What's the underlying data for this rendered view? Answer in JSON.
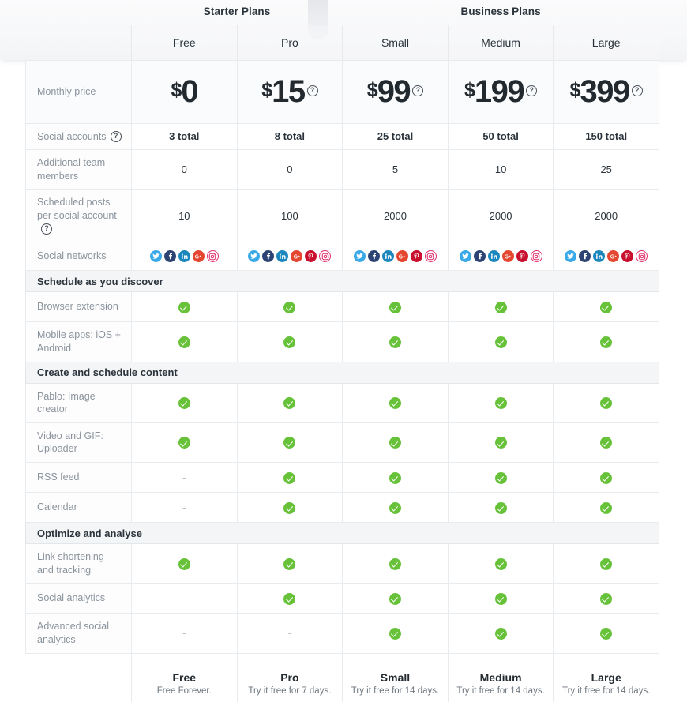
{
  "groups": [
    {
      "label": "Starter Plans",
      "span": 2
    },
    {
      "label": "Business Plans",
      "span": 3
    }
  ],
  "plans": [
    {
      "name": "Free",
      "price_currency": "$",
      "price_amount": "0",
      "has_help": false
    },
    {
      "name": "Pro",
      "price_currency": "$",
      "price_amount": "15",
      "has_help": true
    },
    {
      "name": "Small",
      "price_currency": "$",
      "price_amount": "99",
      "has_help": true
    },
    {
      "name": "Medium",
      "price_currency": "$",
      "price_amount": "199",
      "has_help": true
    },
    {
      "name": "Large",
      "price_currency": "$",
      "price_amount": "399",
      "has_help": true
    }
  ],
  "rows": {
    "monthly_price_label": "Monthly price",
    "social_accounts_label": "Social accounts",
    "social_accounts_values": [
      "3 total",
      "8 total",
      "25 total",
      "50 total",
      "150 total"
    ],
    "team_members_label": "Additional team members",
    "team_members_values": [
      "0",
      "0",
      "5",
      "10",
      "25"
    ],
    "scheduled_posts_label": "Scheduled posts per social account",
    "scheduled_posts_values": [
      "10",
      "100",
      "2000",
      "2000",
      "2000"
    ],
    "social_networks_label": "Social networks",
    "social_networks_values": [
      [
        "twitter",
        "facebook",
        "linkedin",
        "googleplus",
        "instagram"
      ],
      [
        "twitter",
        "facebook",
        "linkedin",
        "googleplus",
        "pinterest",
        "instagram"
      ],
      [
        "twitter",
        "facebook",
        "linkedin",
        "googleplus",
        "pinterest",
        "instagram"
      ],
      [
        "twitter",
        "facebook",
        "linkedin",
        "googleplus",
        "pinterest",
        "instagram"
      ],
      [
        "twitter",
        "facebook",
        "linkedin",
        "googleplus",
        "pinterest",
        "instagram"
      ]
    ]
  },
  "sections": [
    {
      "title": "Schedule as you discover",
      "features": [
        {
          "label": "Browser extension",
          "values": [
            "yes",
            "yes",
            "yes",
            "yes",
            "yes"
          ]
        },
        {
          "label": "Mobile apps: iOS + Android",
          "values": [
            "yes",
            "yes",
            "yes",
            "yes",
            "yes"
          ]
        }
      ]
    },
    {
      "title": "Create and schedule content",
      "features": [
        {
          "label": "Pablo: Image creator",
          "values": [
            "yes",
            "yes",
            "yes",
            "yes",
            "yes"
          ]
        },
        {
          "label": "Video and GIF: Uploader",
          "values": [
            "yes",
            "yes",
            "yes",
            "yes",
            "yes"
          ]
        },
        {
          "label": "RSS feed",
          "values": [
            "no",
            "yes",
            "yes",
            "yes",
            "yes"
          ]
        },
        {
          "label": "Calendar",
          "values": [
            "no",
            "yes",
            "yes",
            "yes",
            "yes"
          ]
        }
      ]
    },
    {
      "title": "Optimize and analyse",
      "features": [
        {
          "label": "Link shortening and tracking",
          "values": [
            "yes",
            "yes",
            "yes",
            "yes",
            "yes"
          ]
        },
        {
          "label": "Social analytics",
          "values": [
            "no",
            "yes",
            "yes",
            "yes",
            "yes"
          ]
        },
        {
          "label": "Advanced social analytics",
          "values": [
            "no",
            "no",
            "yes",
            "yes",
            "yes"
          ]
        }
      ]
    }
  ],
  "footer": [
    {
      "name": "Free",
      "sub": "Free Forever."
    },
    {
      "name": "Pro",
      "sub": "Try it free for 7 days."
    },
    {
      "name": "Small",
      "sub": "Try it free for 14 days."
    },
    {
      "name": "Medium",
      "sub": "Try it free for 14 days."
    },
    {
      "name": "Large",
      "sub": "Try it free for 14 days."
    }
  ],
  "icons": {
    "help": "?",
    "check": "check-circle-icon",
    "dash": "-"
  },
  "colors": {
    "check_green": "#67c23a",
    "section_bg": "#f3f5f7",
    "label_text": "#8a939c",
    "twitter": "#3aa9e8",
    "facebook": "#2d4373",
    "linkedin": "#1c87bd",
    "googleplus": "#e4462f",
    "pinterest": "#c8102e",
    "instagram": "#e1306c"
  }
}
